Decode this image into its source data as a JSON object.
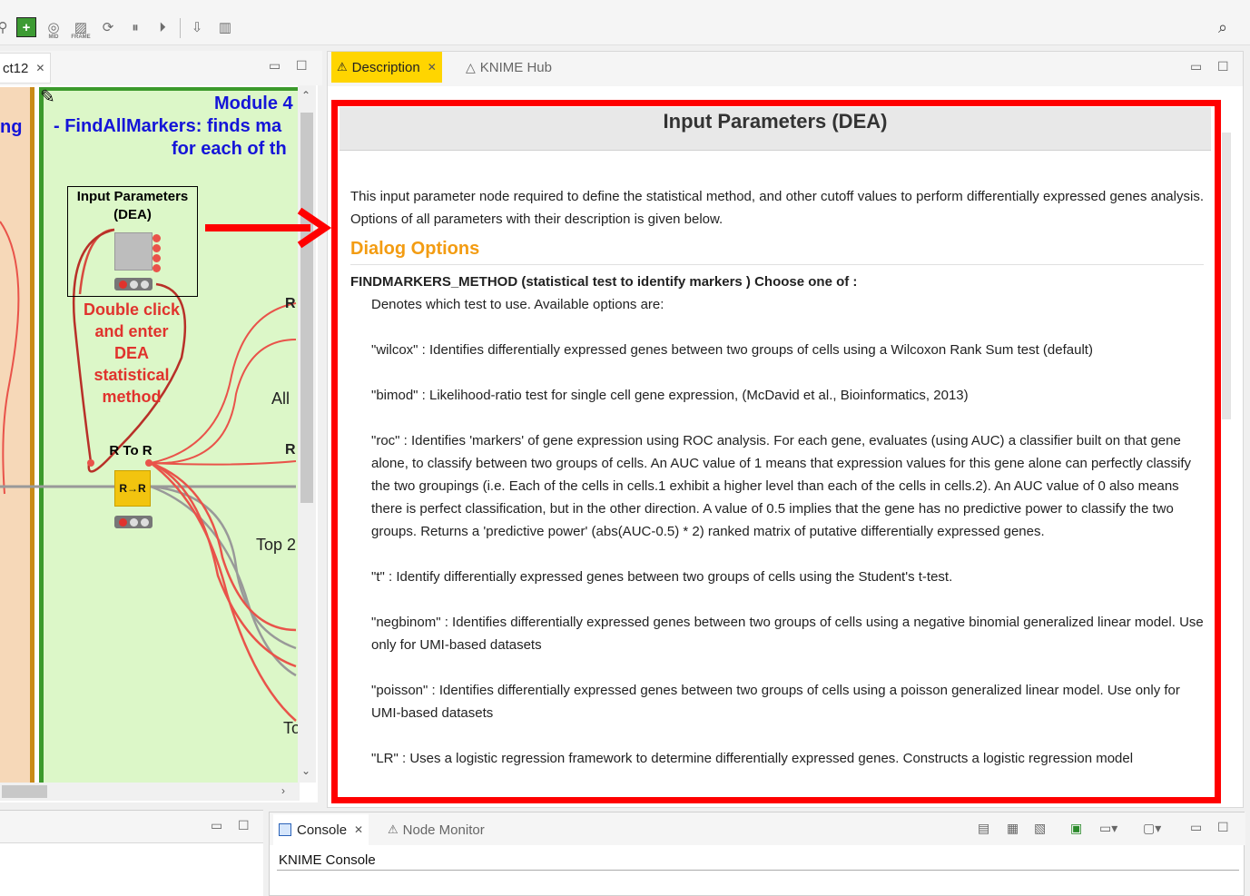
{
  "toolbar": {
    "items": [
      "magnifier-partial-icon",
      "add-node-icon",
      "view-id-icon",
      "frame-icon",
      "execute-icon",
      "pause-icon",
      "resume-icon",
      "deploy-icon",
      "layout-icon"
    ],
    "small_label_1": "MID",
    "small_label_2": "FRAME"
  },
  "editor": {
    "tab_label": "ct12",
    "module_title_line1": "Module 4",
    "module_title_line2": "- FindAllMarkers: finds ma",
    "module_title_line3": "for each of th",
    "left_fragment": "ng",
    "input_node_label_line1": "Input Parameters",
    "input_node_label_line2": "(DEA)",
    "instruction_lines": [
      "Double click",
      "and enter",
      "DEA",
      "statistical",
      "method"
    ],
    "r_to_r_label": "R To R",
    "r_node_text": "R→R",
    "right_labels": [
      "R",
      "All",
      "R",
      "Top 2",
      "To"
    ]
  },
  "description_panel": {
    "tabs": [
      {
        "label": "Description",
        "active": true
      },
      {
        "label": "KNIME Hub",
        "active": false
      }
    ],
    "title": "Input Parameters (DEA)",
    "intro": "This input parameter node required to define the statistical method, and other cutoff values to perform differentially expressed genes analysis. Options of all parameters with their description is given below.",
    "section_heading": "Dialog Options",
    "option_title": "FINDMARKERS_METHOD (statistical test to identify markers ) Choose one of :",
    "option_paragraphs": [
      "Denotes which test to use. Available options are:",
      "\"wilcox\" : Identifies differentially expressed genes between two groups of cells using a Wilcoxon Rank Sum test (default)",
      "\"bimod\" : Likelihood-ratio test for single cell gene expression, (McDavid et al., Bioinformatics, 2013)",
      "\"roc\" : Identifies 'markers' of gene expression using ROC analysis. For each gene, evaluates (using AUC) a classifier built on that gene alone, to classify between two groups of cells. An AUC value of 1 means that expression values for this gene alone can perfectly classify the two groupings (i.e. Each of the cells in cells.1 exhibit a higher level than each of the cells in cells.2). An AUC value of 0 also means there is perfect classification, but in the other direction. A value of 0.5 implies that the gene has no predictive power to classify the two groups. Returns a 'predictive power' (abs(AUC-0.5) * 2) ranked matrix of putative differentially expressed genes.",
      "\"t\" : Identify differentially expressed genes between two groups of cells using the Student's t-test.",
      "\"negbinom\" : Identifies differentially expressed genes between two groups of cells using a negative binomial generalized linear model. Use only for UMI-based datasets",
      "\"poisson\" : Identifies differentially expressed genes between two groups of cells using a poisson generalized linear model. Use only for UMI-based datasets",
      "\"LR\" : Uses a logistic regression framework to determine differentially expressed genes. Constructs a logistic regression model"
    ]
  },
  "console": {
    "tabs": [
      {
        "label": "Console",
        "active": true
      },
      {
        "label": "Node Monitor",
        "active": false
      }
    ],
    "title": "KNIME Console"
  },
  "colors": {
    "highlight": "#ff0000",
    "module_title": "#1515d8",
    "instruction": "#e0332d",
    "active_tab": "#ffd500",
    "section_heading": "#f39c12"
  }
}
